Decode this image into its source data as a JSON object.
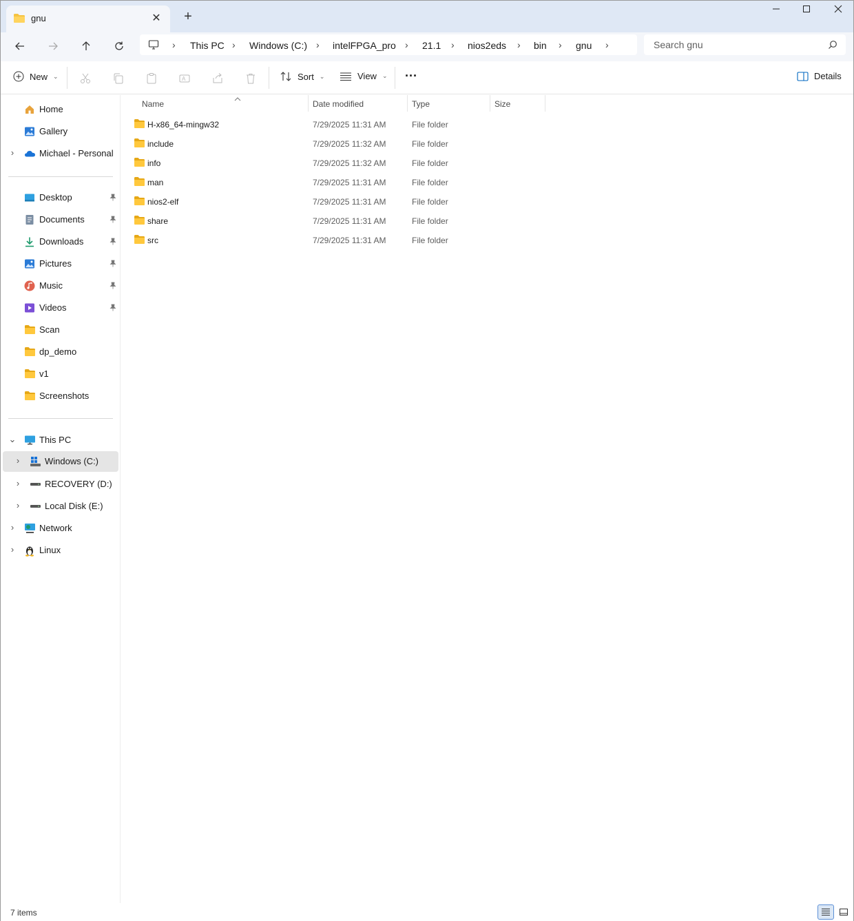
{
  "tab": {
    "title": "gnu",
    "close_glyph": "✕",
    "new_tab_glyph": "+"
  },
  "window_controls": {
    "minimize": "—",
    "maximize": "☐",
    "close": "✕"
  },
  "breadcrumb": {
    "items": [
      "This PC",
      "Windows (C:)",
      "intelFPGA_pro",
      "21.1",
      "nios2eds",
      "bin",
      "gnu"
    ],
    "separator": "›"
  },
  "search": {
    "placeholder": "Search gnu"
  },
  "toolbar": {
    "new_label": "New",
    "sort_label": "Sort",
    "view_label": "View",
    "more_label": "···",
    "details_label": "Details"
  },
  "sidebar": {
    "quick": [
      {
        "label": "Home",
        "icon": "home-icon"
      },
      {
        "label": "Gallery",
        "icon": "gallery-icon"
      },
      {
        "label": "Michael - Personal",
        "icon": "onedrive-icon"
      }
    ],
    "pinned": [
      {
        "label": "Desktop",
        "icon": "desktop-icon",
        "pinned": true
      },
      {
        "label": "Documents",
        "icon": "documents-icon",
        "pinned": true
      },
      {
        "label": "Downloads",
        "icon": "downloads-icon",
        "pinned": true
      },
      {
        "label": "Pictures",
        "icon": "pictures-icon",
        "pinned": true
      },
      {
        "label": "Music",
        "icon": "music-icon",
        "pinned": true
      },
      {
        "label": "Videos",
        "icon": "videos-icon",
        "pinned": true
      },
      {
        "label": "Scan",
        "icon": "folder-icon",
        "pinned": false
      },
      {
        "label": "dp_demo",
        "icon": "folder-icon",
        "pinned": false
      },
      {
        "label": "v1",
        "icon": "folder-icon",
        "pinned": false
      },
      {
        "label": "Screenshots",
        "icon": "folder-icon",
        "pinned": false
      }
    ],
    "this_pc_label": "This PC",
    "drives": [
      {
        "label": "Windows (C:)",
        "selected": true
      },
      {
        "label": "RECOVERY (D:)",
        "selected": false
      },
      {
        "label": "Local Disk (E:)",
        "selected": false
      }
    ],
    "network_label": "Network",
    "linux_label": "Linux"
  },
  "columns": {
    "name": "Name",
    "date": "Date modified",
    "type": "Type",
    "size": "Size"
  },
  "files": [
    {
      "name": "H-x86_64-mingw32",
      "date": "7/29/2025 11:31 AM",
      "type": "File folder"
    },
    {
      "name": "include",
      "date": "7/29/2025 11:32 AM",
      "type": "File folder"
    },
    {
      "name": "info",
      "date": "7/29/2025 11:32 AM",
      "type": "File folder"
    },
    {
      "name": "man",
      "date": "7/29/2025 11:31 AM",
      "type": "File folder"
    },
    {
      "name": "nios2-elf",
      "date": "7/29/2025 11:31 AM",
      "type": "File folder"
    },
    {
      "name": "share",
      "date": "7/29/2025 11:31 AM",
      "type": "File folder"
    },
    {
      "name": "src",
      "date": "7/29/2025 11:31 AM",
      "type": "File folder"
    }
  ],
  "status": {
    "item_count": "7 items"
  },
  "colors": {
    "folder": "#f5c342",
    "folder_dark": "#e6a817",
    "accent": "#0067c0",
    "titlebar": "#dfe8f5"
  }
}
